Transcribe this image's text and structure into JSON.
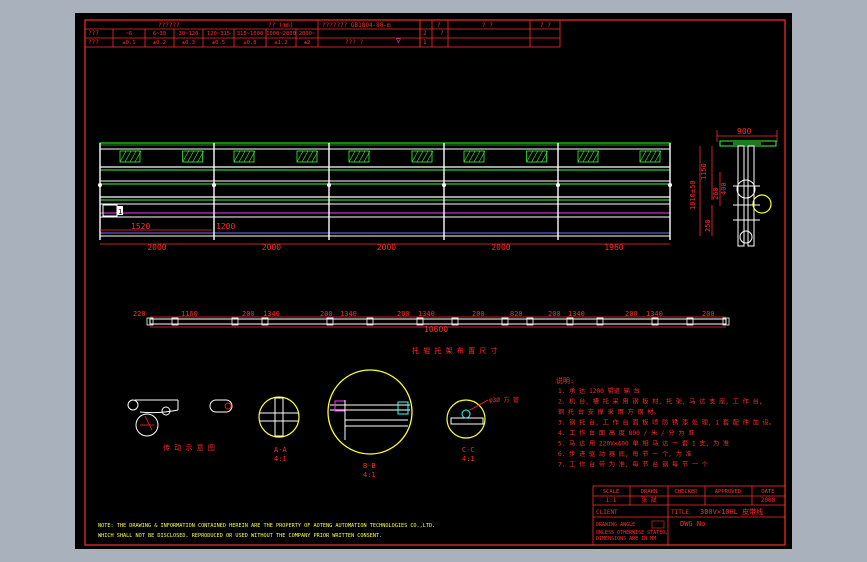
{
  "tolerance_table": {
    "header_title": "??????",
    "header_mid": "?? (mm)",
    "header_std": "??????? GB1804-80-m",
    "row_label_1": "???",
    "row_label_2": "???",
    "ranges": [
      "~6",
      "6~30",
      "30~120",
      "120~315",
      "315~1000",
      "1000~2000",
      "2000~"
    ],
    "tolerances": [
      "±0.1",
      "±0.2",
      "±0.3",
      "±0.5",
      "±0.8",
      "±1.2",
      "±2"
    ],
    "angle_label": "??? ?",
    "angle_symbol": "▽"
  },
  "revision_table": {
    "col_a": "?",
    "col_b": "? ?",
    "col_c": "? ?",
    "rows": [
      "2",
      "1",
      "?"
    ]
  },
  "front_view": {
    "bottom_dims": [
      "2000",
      "2000",
      "2000",
      "2000",
      "1960"
    ],
    "inner_dims": [
      "1520",
      "1200"
    ],
    "end_label": "1"
  },
  "side_view": {
    "width_dim": "900",
    "height_dims": [
      "1150",
      "1810±50",
      "250",
      "260",
      "400"
    ]
  },
  "rail_layout": {
    "top_dims": [
      "220",
      "1160",
      "200",
      "1340",
      "200",
      "1340",
      "200",
      "1340",
      "200",
      "820",
      "200",
      "1340",
      "200",
      "1340",
      "200"
    ],
    "total": "10600",
    "caption": "托 辊 托 架 布 置 尺 寸"
  },
  "details": {
    "drive_label": "传 动 示 意 图",
    "a_label": "A-A",
    "a_scale": "4:1",
    "b_label": "B-B",
    "b_scale": "4:1",
    "c_label": "C-C",
    "c_scale": "4:1",
    "c_note": "φ3Ø 方 管"
  },
  "notes": {
    "title": "说明:",
    "items": [
      "1. 承 达 1200 辊道 输 台",
      "2. 机 台,   槽 托 采 用 钢 板 材,  托 架,   马 达 支 座,   工 作 台,",
      "   钢 托 台 支 撑 采 用 方 钢 材。",
      "3. 钢 托 台,   工 作 台 面 板 喷 防 锈 漆 处 理,   1 套 配 件 加 设。",
      "4. 工 作 台 面 高 度 800 / 米 / 分 为 准",
      "5. 马 达 用 220V×400 单 相 马 达 一 套 1 支,   为 准",
      "6. 步 进 驱 动 器 底,   每 节 一 个,   为 准",
      "7. 工 作 台 带 为 准,   每 节 台 钢 每 节 一 个"
    ]
  },
  "title_block": {
    "headers": [
      "SCALE",
      "DRAWN",
      "CHECKED",
      "APPROVED",
      "DATE"
    ],
    "values": [
      "1:1",
      "张 斌",
      "",
      "",
      "2008"
    ],
    "client_label": "CLIENT",
    "title_label": "TITLE",
    "title_value": "300V×10HL 皮带线",
    "drawing_angle": "DRAWING ANGLE",
    "unless": "UNLESS OTHERWISE STATED,",
    "dimensions": "DIMENSIONS ARE IN MM",
    "dwg_label": "DWG No"
  },
  "footer_note": {
    "line1": "NOTE: THE DRAWING & INFORMATION CONTAINED HEREIN ARE THE PROPERTY OF AOTENG AUTOMATION TECHNOLOGIES CO.,LTD.",
    "line2": "WHICH   SHALL NOT BE DISCLOSED, REPRODUCED OR USED WITHOUT THE COMPANY PRIOR WRITTEN CONSENT."
  }
}
